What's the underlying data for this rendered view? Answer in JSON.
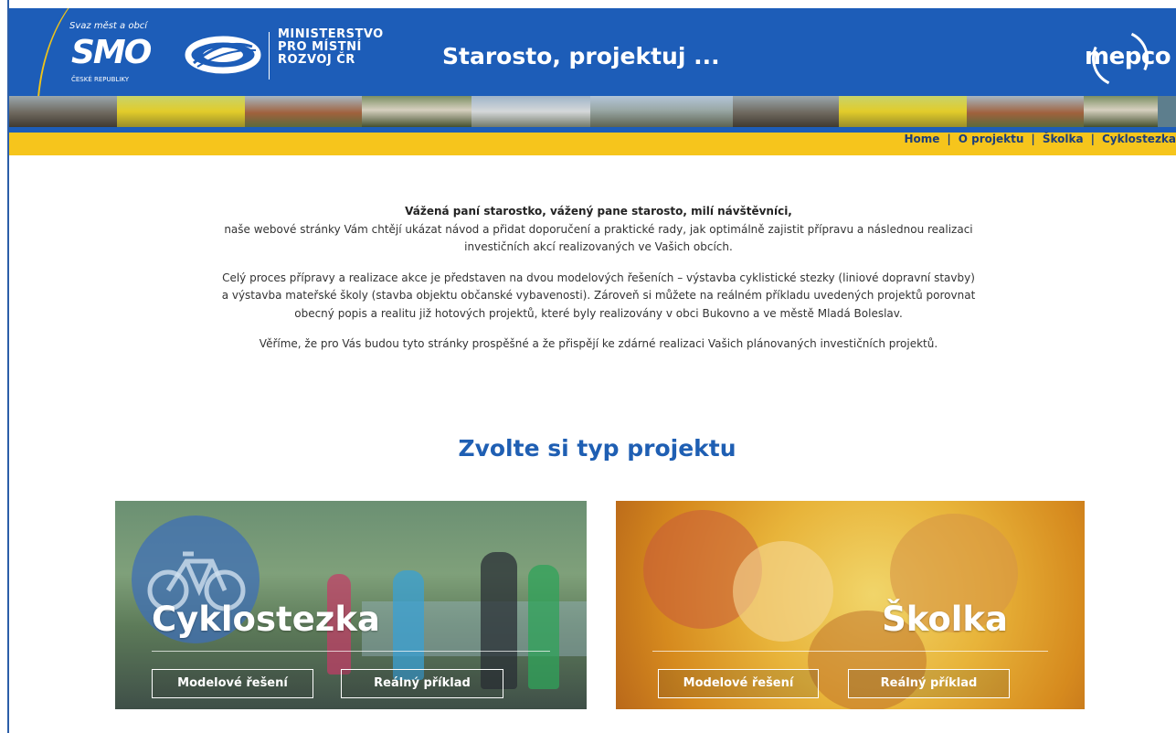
{
  "header": {
    "smo_logo": {
      "top": "Svaz měst a obcí",
      "mark": "SMO",
      "bottom": "ČESKÉ REPUBLIKY"
    },
    "ministry_lines": [
      "MINISTERSTVO",
      "PRO MÍSTNÍ",
      "ROZVOJ ČR"
    ],
    "site_title": "Starosto, projektuj ...",
    "partner_logo": "mepco"
  },
  "nav": {
    "items": [
      "Home",
      "O projektu",
      "Školka",
      "Cyklostezka"
    ],
    "separator": "|"
  },
  "intro": {
    "greeting": "Vážená paní starostko, vážený pane starosto, milí návštěvníci,",
    "p1": "naše webové stránky Vám chtějí ukázat návod a přidat doporučení a praktické rady, jak optimálně zajistit přípravu a následnou realizaci investičních akcí realizovaných ve Vašich obcích.",
    "p2": "Celý proces přípravy a realizace akce je představen na dvou modelových řešeních – výstavba cyklistické stezky (liniové dopravní stavby) a výstavba mateřské školy (stavba objektu občanské vybavenosti). Zároveň si můžete na reálném příkladu uvedených projektů porovnat obecný popis a realitu již hotových projektů, které byly realizovány v obci Bukovno a ve městě Mladá Boleslav.",
    "p3": "Věříme, že pro Vás budou tyto stránky prospěšné a že přispějí ke zdárné realizaci Vašich plánovaných investičních projektů."
  },
  "choose_heading": "Zvolte si typ projektu",
  "cards": [
    {
      "title": "Cyklostezka",
      "btn_model": "Modelové řešení",
      "btn_real": "Reálný příklad"
    },
    {
      "title": "Školka",
      "btn_model": "Modelové řešení",
      "btn_real": "Reálný příklad"
    }
  ],
  "colors": {
    "header_blue": "#1d5db8",
    "accent_yellow": "#f6c51c",
    "heading_blue": "#1f5fb3",
    "nav_text": "#1c3e7a"
  }
}
